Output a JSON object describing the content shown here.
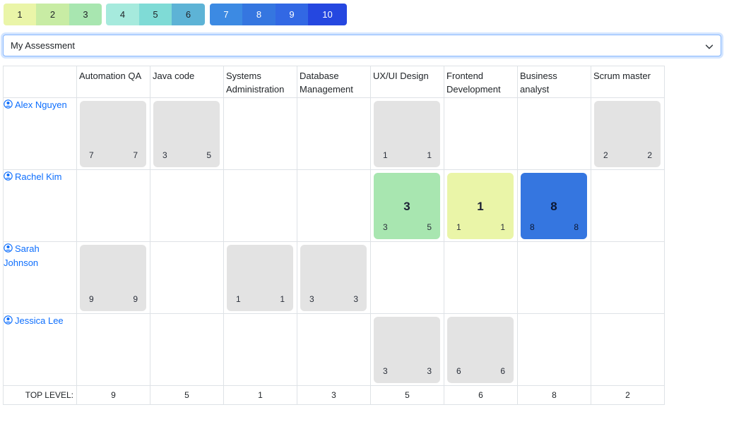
{
  "legend": {
    "groups": [
      {
        "levels": [
          {
            "label": "1",
            "bg": "#eaf5a8",
            "fg": "#212529"
          },
          {
            "label": "2",
            "bg": "#c8eca4",
            "fg": "#212529"
          },
          {
            "label": "3",
            "bg": "#a8e6b0",
            "fg": "#212529"
          }
        ]
      },
      {
        "levels": [
          {
            "label": "4",
            "bg": "#a6eadd",
            "fg": "#212529"
          },
          {
            "label": "5",
            "bg": "#7fdbd6",
            "fg": "#212529"
          },
          {
            "label": "6",
            "bg": "#5db3d6",
            "fg": "#212529"
          }
        ]
      },
      {
        "levels": [
          {
            "label": "7",
            "bg": "#3c8ae3",
            "fg": "#ffffff"
          },
          {
            "label": "8",
            "bg": "#3576e0",
            "fg": "#ffffff"
          },
          {
            "label": "9",
            "bg": "#3268e4",
            "fg": "#ffffff"
          },
          {
            "label": "10",
            "bg": "#2547e0",
            "fg": "#ffffff"
          }
        ]
      }
    ]
  },
  "assessment_select": {
    "value": "My Assessment",
    "icon": "chevron-down-icon"
  },
  "columns": [
    "Automation QA",
    "Java code",
    "Systems Administration",
    "Database Management",
    "UX/UI Design",
    "Frontend Development",
    "Business analyst",
    "Scrum master"
  ],
  "people": [
    {
      "name": "Alex  Nguyen",
      "icon": "person-circle-icon",
      "cells": [
        {
          "left": "7",
          "right": "7"
        },
        {
          "left": "3",
          "right": "5"
        },
        null,
        null,
        {
          "left": "1",
          "right": "1"
        },
        null,
        null,
        {
          "left": "2",
          "right": "2"
        }
      ]
    },
    {
      "name": "Rachel Kim",
      "icon": "person-circle-icon",
      "cells": [
        null,
        null,
        null,
        null,
        {
          "center": "3",
          "left": "3",
          "right": "5",
          "color": "#a8e6b0"
        },
        {
          "center": "1",
          "left": "1",
          "right": "1",
          "color": "#eaf5a8"
        },
        {
          "center": "8",
          "left": "8",
          "right": "8",
          "color": "#3576e0"
        },
        null
      ]
    },
    {
      "name": "Sarah Johnson",
      "icon": "person-circle-icon",
      "cells": [
        {
          "left": "9",
          "right": "9"
        },
        null,
        {
          "left": "1",
          "right": "1"
        },
        {
          "left": "3",
          "right": "3"
        },
        null,
        null,
        null,
        null
      ]
    },
    {
      "name": "Jessica Lee",
      "icon": "person-circle-icon",
      "cells": [
        null,
        null,
        null,
        null,
        {
          "left": "3",
          "right": "3"
        },
        {
          "left": "6",
          "right": "6"
        },
        null,
        null
      ]
    }
  ],
  "footer": {
    "label": "TOP LEVEL:",
    "values": [
      "9",
      "5",
      "1",
      "3",
      "5",
      "6",
      "8",
      "2"
    ]
  }
}
